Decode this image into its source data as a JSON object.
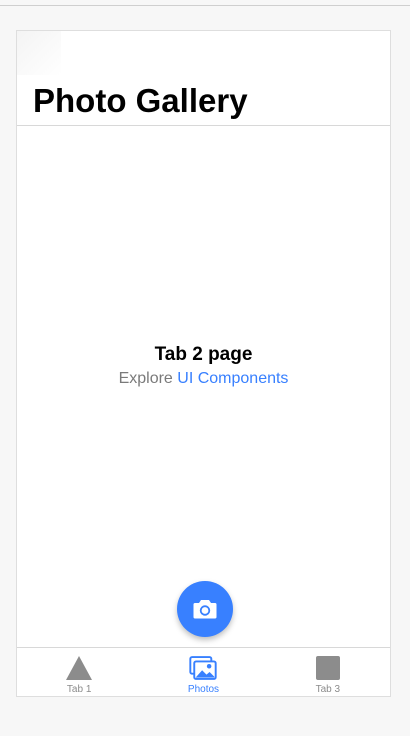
{
  "header": {
    "title": "Photo Gallery"
  },
  "content": {
    "heading": "Tab 2 page",
    "sub_prefix": "Explore",
    "sub_link": "UI Components"
  },
  "fab": {
    "icon": "camera-icon"
  },
  "tabs": [
    {
      "label": "Tab 1",
      "icon": "triangle-icon",
      "active": false
    },
    {
      "label": "Photos",
      "icon": "images-icon",
      "active": true
    },
    {
      "label": "Tab 3",
      "icon": "square-icon",
      "active": false
    }
  ],
  "colors": {
    "accent": "#3880ff",
    "inactive": "#8c8c8c",
    "text_muted": "#7a7a7a"
  }
}
